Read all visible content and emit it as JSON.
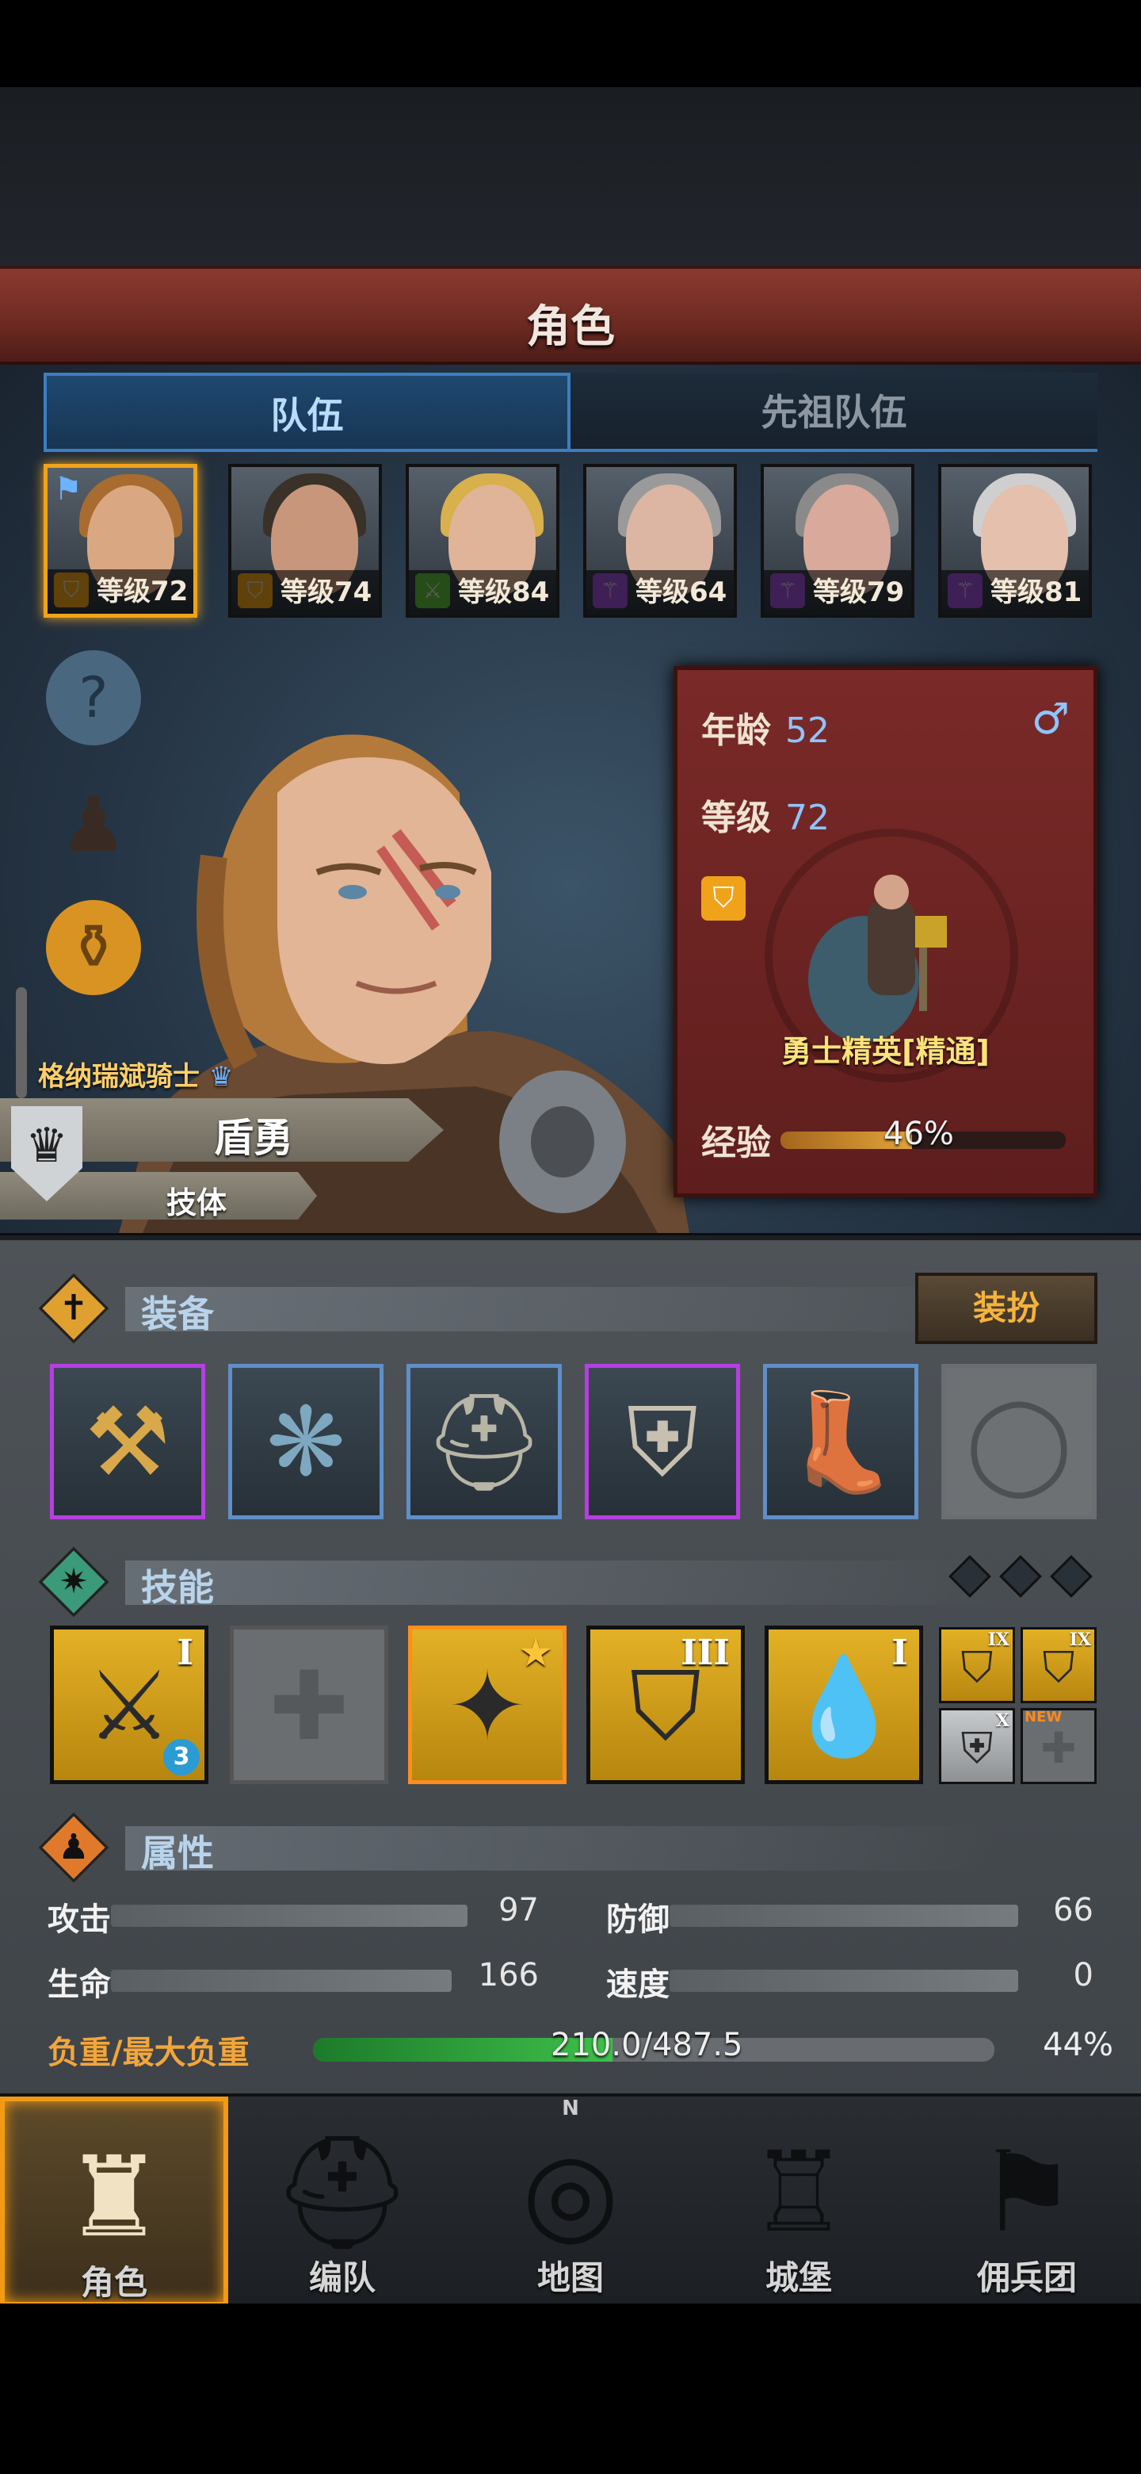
{
  "title": "角色",
  "tabs": [
    {
      "label": "队伍",
      "active": true
    },
    {
      "label": "先祖队伍",
      "active": false
    }
  ],
  "party": [
    {
      "level_label": "等级72",
      "class_color": "#f0a31a",
      "class_icon": "shield-icon",
      "selected": true
    },
    {
      "level_label": "等级74",
      "class_color": "#f0a31a",
      "class_icon": "shield-icon",
      "selected": false
    },
    {
      "level_label": "等级84",
      "class_color": "#5fbf3a",
      "class_icon": "swords-icon",
      "selected": false
    },
    {
      "level_label": "等级64",
      "class_color": "#9b4fd6",
      "class_icon": "staff-icon",
      "selected": false
    },
    {
      "level_label": "等级79",
      "class_color": "#9b4fd6",
      "class_icon": "staff-icon",
      "selected": false
    },
    {
      "level_label": "等级81",
      "class_color": "#9b4fd6",
      "class_icon": "staff-icon",
      "selected": false
    }
  ],
  "info_card": {
    "age_label": "年龄",
    "age": "52",
    "level_label": "等级",
    "level": "72",
    "gender_icon": "male-icon",
    "gender_symbol": "♂",
    "class_name": "勇士精英[精通]",
    "exp_label": "经验",
    "exp_percent_text": "46%",
    "exp_fraction": 0.46
  },
  "character": {
    "origin": "格纳瑞斌骑士",
    "class": "盾勇",
    "trait": "技体"
  },
  "equipment": {
    "section_label": "装备",
    "dress_button": "装扮",
    "slots": [
      {
        "name": "hammer-weapon",
        "glyph": "⚒",
        "rarity": "purple"
      },
      {
        "name": "fur-cloak",
        "glyph": "❋",
        "rarity": "blue"
      },
      {
        "name": "helmet",
        "glyph": "⛑",
        "rarity": "blue"
      },
      {
        "name": "chainmail-armor",
        "glyph": "⛨",
        "rarity": "purple"
      },
      {
        "name": "greaves",
        "glyph": "👢",
        "rarity": "blue"
      },
      {
        "name": "empty-ring",
        "glyph": "◯",
        "rarity": "empty"
      }
    ]
  },
  "skills": {
    "section_label": "技能",
    "main": [
      {
        "name": "shield-sword-skill",
        "glyph": "⚔",
        "rank": "I",
        "badge": "3"
      },
      {
        "name": "empty-skill",
        "glyph": "✚",
        "rank": "",
        "badge": ""
      },
      {
        "name": "crow-strike-skill",
        "glyph": "✦",
        "rank": "★",
        "badge": ""
      },
      {
        "name": "shield-up-skill",
        "glyph": "⛉",
        "rank": "III",
        "badge": ""
      },
      {
        "name": "blood-shield-skill",
        "glyph": "💧",
        "rank": "I",
        "badge": ""
      }
    ],
    "mini": [
      {
        "name": "mini-skill-1",
        "glyph": "⛉",
        "rank": "IX"
      },
      {
        "name": "mini-skill-2",
        "glyph": "⛉",
        "rank": "IX"
      },
      {
        "name": "mini-skill-3",
        "glyph": "⛨",
        "rank": "X"
      },
      {
        "name": "mini-skill-4",
        "glyph": "✚",
        "rank": "NEW"
      }
    ]
  },
  "attributes": {
    "section_label": "属性",
    "attack_label": "攻击",
    "attack": "97",
    "defense_label": "防御",
    "defense": "66",
    "hp_label": "生命",
    "hp": "166",
    "speed_label": "速度",
    "speed": "0",
    "load_label": "负重/最大负重",
    "load_text": "210.0/487.5",
    "load_percent": "44%",
    "load_fraction": 0.44
  },
  "nav": [
    {
      "label": "角色",
      "glyph": "♜",
      "active": true
    },
    {
      "label": "编队",
      "glyph": "⛑",
      "active": false
    },
    {
      "label": "地图",
      "glyph": "◎",
      "active": false
    },
    {
      "label": "城堡",
      "glyph": "♖",
      "active": false
    },
    {
      "label": "佣兵团",
      "glyph": "⚑",
      "active": false
    }
  ],
  "compass_letter": "N",
  "colors": {
    "accent": "#f0a31a",
    "tab_blue": "#3c7ec0",
    "card_red": "#7a2a28"
  }
}
